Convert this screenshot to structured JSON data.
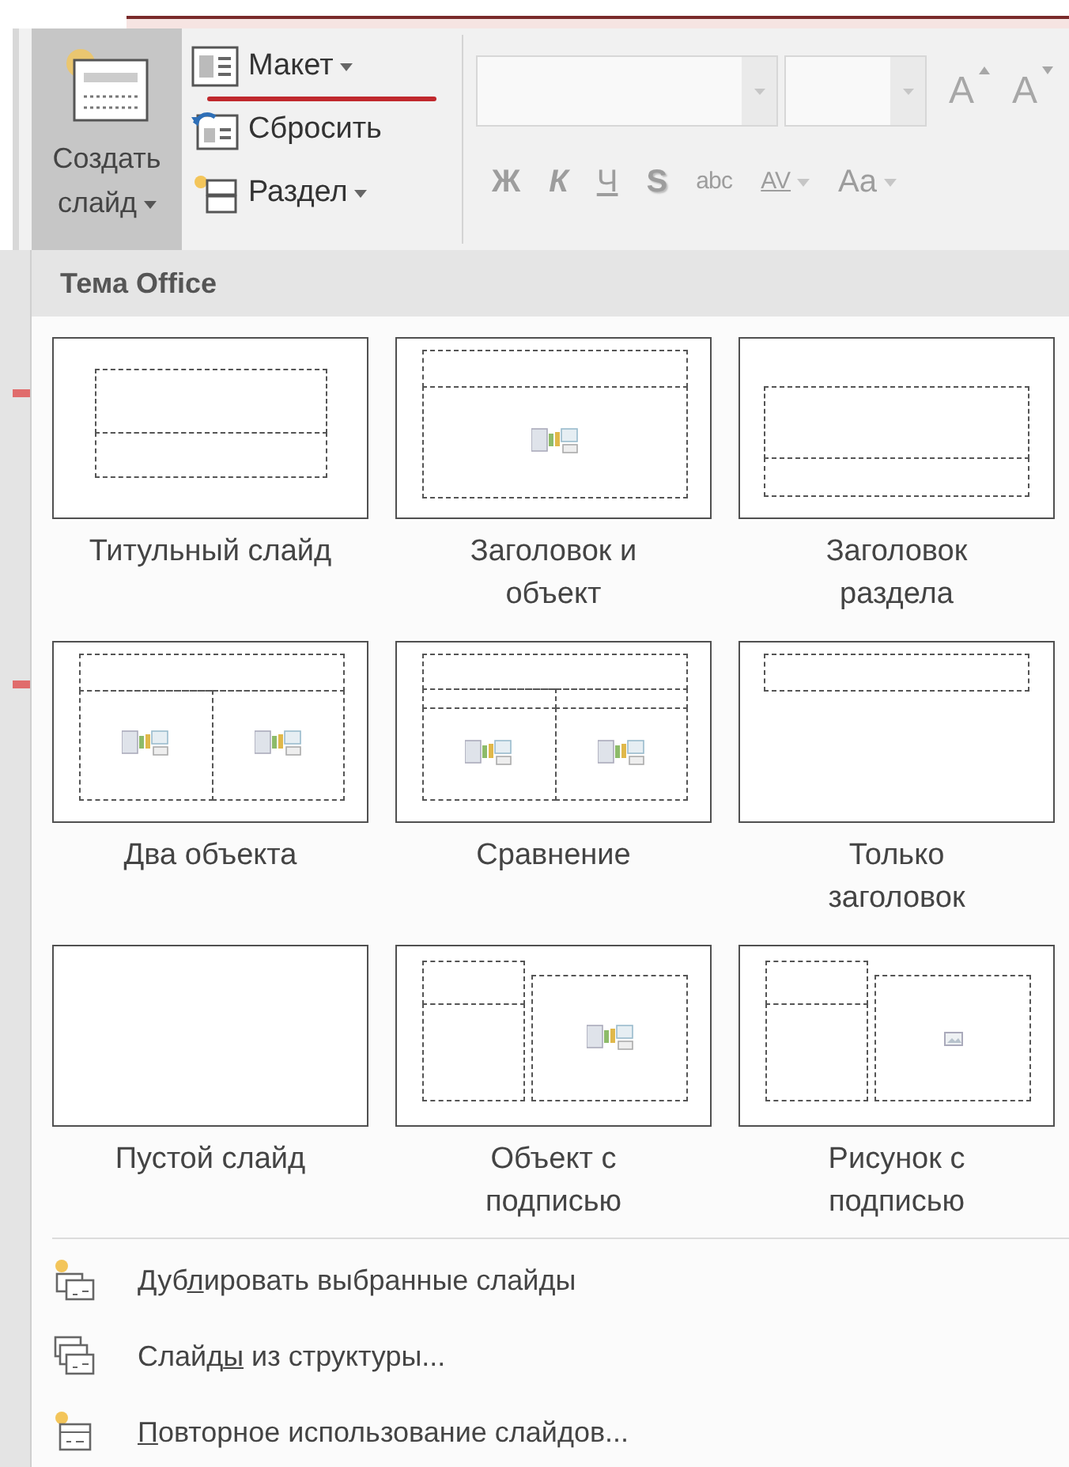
{
  "ribbon": {
    "new_slide": {
      "label": "Создать слайд",
      "selected": true
    },
    "slide_commands": [
      {
        "label": "Макет",
        "kind": "layout",
        "has_menu": true,
        "annotated": true
      },
      {
        "label": "Сбросить",
        "kind": "reset",
        "has_menu": false,
        "annotated": false
      },
      {
        "label": "Раздел",
        "kind": "section",
        "has_menu": true,
        "annotated": false
      }
    ],
    "font": {
      "disabled": true,
      "grow_label": "A",
      "shrink_label": "A",
      "format_buttons": [
        {
          "label": "Ж",
          "kind": "bold",
          "has_menu": false
        },
        {
          "label": "К",
          "kind": "italic",
          "has_menu": false
        },
        {
          "label": "Ч",
          "kind": "underline",
          "has_menu": false
        },
        {
          "label": "S",
          "kind": "shadow",
          "has_menu": false
        },
        {
          "label": "abc",
          "kind": "strike",
          "has_menu": false
        },
        {
          "label": "AV",
          "kind": "spacing",
          "has_menu": true
        },
        {
          "label": "Aa",
          "kind": "case",
          "has_menu": true
        }
      ]
    }
  },
  "layout_menu": {
    "header": "Тема Office",
    "layouts": [
      {
        "label": "Титульный слайд",
        "kind": "title"
      },
      {
        "label": "Заголовок и\nобъект",
        "kind": "title_content"
      },
      {
        "label": "Заголовок\nраздела",
        "kind": "section"
      },
      {
        "label": "Два объекта",
        "kind": "two_content"
      },
      {
        "label": "Сравнение",
        "kind": "comparison"
      },
      {
        "label": "Только\nзаголовок",
        "kind": "title_only"
      },
      {
        "label": "Пустой слайд",
        "kind": "blank"
      },
      {
        "label": "Объект с\nподписью",
        "kind": "content_caption"
      },
      {
        "label": "Рисунок с\nподписью",
        "kind": "picture_caption"
      }
    ],
    "commands": [
      {
        "kind": "duplicate",
        "text_before": "Дуб",
        "access_key": "л",
        "text_after": "ировать выбранные слайды"
      },
      {
        "kind": "outline",
        "text_before": "Слайд",
        "access_key": "ы",
        "text_after": " из структуры..."
      },
      {
        "kind": "reuse",
        "access_key": "П",
        "text_after": "овторное использование слайдов..."
      }
    ]
  }
}
